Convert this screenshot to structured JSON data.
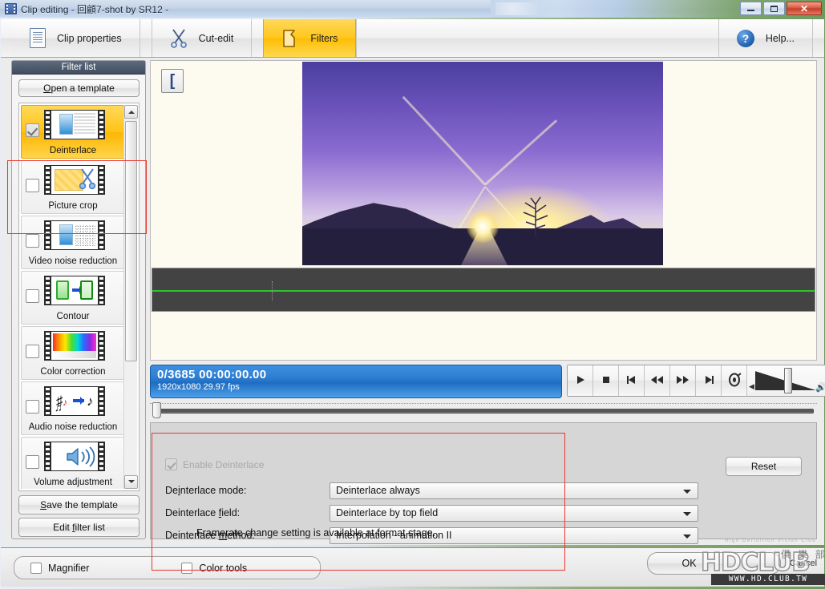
{
  "window": {
    "title": "Clip editing - 回顧7-shot by SR12 -",
    "app_icon": "film-strip-icon",
    "minimize_label": "Minimize",
    "maximize_label": "Maximize",
    "close_label": "✕"
  },
  "toolbar": {
    "tabs": [
      {
        "label": "Clip properties",
        "icon": "document-icon",
        "active": false
      },
      {
        "label": "Cut-edit",
        "icon": "scissors-icon",
        "active": false
      },
      {
        "label": "Filters",
        "icon": "filter-page-icon",
        "active": true
      }
    ],
    "help_label": "Help...",
    "help_icon": "question-circle-icon",
    "active_tab_color": "#ffc71f"
  },
  "filter_panel": {
    "title": "Filter list",
    "open_template_label": "Open a template",
    "open_template_accel": "O",
    "save_template_label": "Save the template",
    "save_template_accel": "S",
    "edit_filter_list_label": "Edit filter list",
    "edit_filter_list_accel": "f",
    "items": [
      {
        "label": "Deinterlace",
        "checked": true,
        "selected": true
      },
      {
        "label": "Picture crop",
        "checked": false,
        "selected": false
      },
      {
        "label": "Video noise reduction",
        "checked": false,
        "selected": false
      },
      {
        "label": "Contour",
        "checked": false,
        "selected": false
      },
      {
        "label": "Color correction",
        "checked": false,
        "selected": false
      },
      {
        "label": "Audio noise reduction",
        "checked": false,
        "selected": false
      },
      {
        "label": "Volume adjustment",
        "checked": false,
        "selected": false
      }
    ],
    "scroll_up_icon": "chevron-up-icon",
    "scroll_down_icon": "chevron-down-icon"
  },
  "preview": {
    "mark_in_label": "[",
    "mark_in_icon": "mark-in-bracket-icon",
    "video_description": "Sunrise over mountain silhouette with purple sky"
  },
  "transport": {
    "timecode_main": "0/3685  00:00:00.00",
    "timecode_sub": "1920x1080 29.97  fps",
    "buttons": [
      {
        "name": "play",
        "icon": "play-icon"
      },
      {
        "name": "stop",
        "icon": "stop-icon"
      },
      {
        "name": "previous-frame",
        "icon": "previous-frame-icon"
      },
      {
        "name": "rewind",
        "icon": "rewind-icon"
      },
      {
        "name": "fast-forward",
        "icon": "fast-forward-icon"
      },
      {
        "name": "next-frame",
        "icon": "next-frame-icon"
      },
      {
        "name": "jog-shuttle",
        "icon": "jog-dial-icon"
      }
    ],
    "volume_icon": "speaker-icon",
    "volume_mute_icon": "speaker-low-icon"
  },
  "settings": {
    "enable_label": "Enable Deinterlace",
    "enable_checked": true,
    "enable_disabled": true,
    "rows": [
      {
        "label": "Deinterlace mode:",
        "accel": "i",
        "value": "Deinterlace always"
      },
      {
        "label": "Deinterlace field:",
        "accel": "f",
        "value": "Deinterlace by top field"
      },
      {
        "label": "Deinterlace method:",
        "accel": "m",
        "value": "Interpolation - animation II"
      }
    ],
    "hint": "Framerate change setting is available at format stage.",
    "reset_label": "Reset"
  },
  "bottom": {
    "magnifier_label": "Magnifier",
    "magnifier_checked": false,
    "color_tools_label": "Color tools",
    "color_tools_checked": false,
    "ok_label": "OK",
    "cancel_label": "Cancel"
  },
  "watermark": {
    "tagline": "High Definition Vision Club",
    "logo": "HD",
    "logo_suffix": "CLUB",
    "chinese": "俱 樂 部 專 業 所",
    "url": "WWW.HD.CLUB.TW"
  },
  "colors": {
    "accent": "#ffc71f",
    "timecode_blue": "#2f7fd4",
    "annotation_red": "#e8372f",
    "waveform_green": "#2fc32f"
  }
}
